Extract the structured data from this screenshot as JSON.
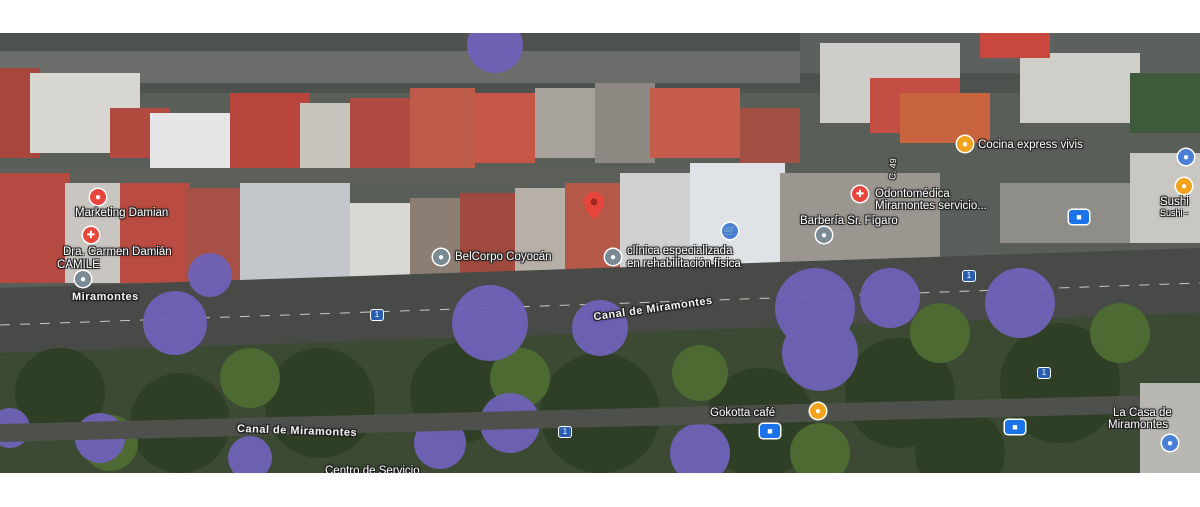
{
  "map": {
    "roads": {
      "canal_upper": "Canal de Miramontes",
      "canal_lower": "Canal de Miramontes",
      "miramontes_left": "Miramontes",
      "c49": "C. 49",
      "route_shield": "1"
    },
    "places": {
      "marketing": "Marketing Damian",
      "dra_line1": "Dra. Carmen Damián",
      "dra_line2": "CAMILE",
      "belcorpo": "BelCorpo Coyocán",
      "clinica_line1": "clínica especializada",
      "clinica_line2": "en rehabilitación física",
      "barberia": "Barbería Sr. Fígaro",
      "odonto_line1": "Odontomédica",
      "odonto_line2": "Miramontes servicio...",
      "cocina": "Cocina express vivis",
      "sushi_line1": "Sushi",
      "sushi_line2": "Sushi -",
      "gokotta": "Gokotta café",
      "lacasa_line1": "La Casa de",
      "lacasa_line2": "Miramontes",
      "centro": "Centro de Servicio"
    },
    "colors": {
      "pin_red": "#e8453c",
      "pin_blue": "#4a7fd6",
      "pin_orange": "#f2a31b",
      "jacaranda": "#6f62b8",
      "transit": "#1a73e8"
    },
    "icons": [
      "location-pin-icon",
      "restaurant-icon",
      "bus-stop-icon",
      "shopping-icon",
      "place-icon"
    ]
  }
}
